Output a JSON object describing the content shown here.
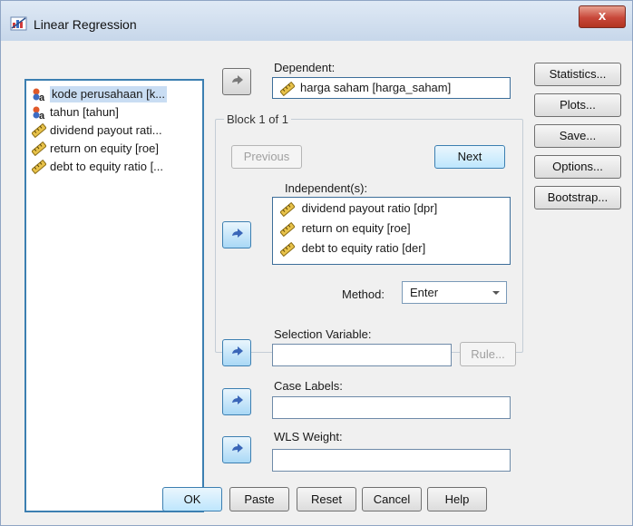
{
  "window": {
    "title": "Linear Regression",
    "close_symbol": "x"
  },
  "variables": [
    {
      "label": "kode perusahaan [k...",
      "icon": "nominal-icon",
      "selected": true
    },
    {
      "label": "tahun [tahun]",
      "icon": "nominal-icon",
      "selected": false
    },
    {
      "label": "dividend payout rati...",
      "icon": "scale-ruler-icon",
      "selected": false
    },
    {
      "label": "return on equity [roe]",
      "icon": "scale-ruler-icon",
      "selected": false
    },
    {
      "label": "debt to equity ratio [...",
      "icon": "scale-ruler-icon",
      "selected": false
    }
  ],
  "dependent": {
    "label": "Dependent:",
    "value": "harga saham [harga_saham]"
  },
  "block": {
    "legend": "Block 1 of 1",
    "previous": "Previous",
    "next": "Next",
    "independent_label": "Independent(s):",
    "independents": [
      "dividend payout ratio [dpr]",
      "return on equity [roe]",
      "debt to equity ratio [der]"
    ],
    "method_label": "Method:",
    "method_value": "Enter"
  },
  "selection": {
    "label": "Selection Variable:",
    "value": "",
    "rule": "Rule..."
  },
  "case_labels": {
    "label": "Case Labels:",
    "value": ""
  },
  "wls": {
    "label": "WLS Weight:",
    "value": ""
  },
  "side_buttons": [
    "Statistics...",
    "Plots...",
    "Save...",
    "Options...",
    "Bootstrap..."
  ],
  "footer_buttons": [
    "OK",
    "Paste",
    "Reset",
    "Cancel",
    "Help"
  ],
  "colors": {
    "focus_border": "#3c7fb1",
    "arrow_active": "#3a66b8",
    "arrow_inactive": "#7a7a7a"
  }
}
